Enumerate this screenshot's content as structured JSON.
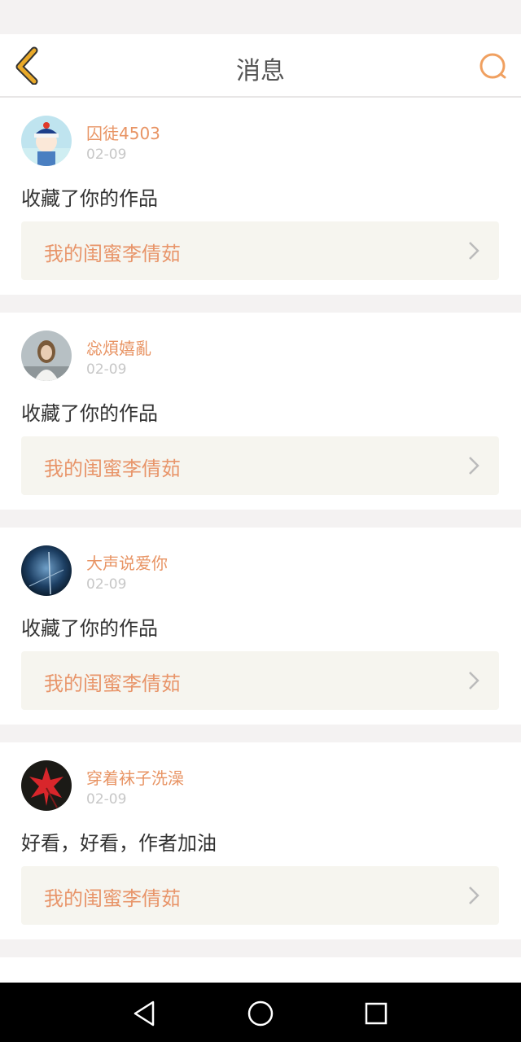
{
  "header": {
    "title": "消息",
    "back_icon": "back-chevron-icon",
    "search_icon": "search-icon"
  },
  "colors": {
    "accent": "#e89464",
    "back_icon": "#e9a929",
    "link_bg": "#f6f5ef"
  },
  "messages": [
    {
      "username": "囚徒4503",
      "date": "02-09",
      "comment": "收藏了你的作品",
      "work_title": "我的闺蜜李倩茹",
      "avatar": "avatar-cartoon"
    },
    {
      "username": "惢煩嬉亂",
      "date": "02-09",
      "comment": "收藏了你的作品",
      "work_title": "我的闺蜜李倩茹",
      "avatar": "avatar-photo-girl"
    },
    {
      "username": "大声说爱你",
      "date": "02-09",
      "comment": "收藏了你的作品",
      "work_title": "我的闺蜜李倩茹",
      "avatar": "avatar-photo-dark"
    },
    {
      "username": "穿着袜子洗澡",
      "date": "02-09",
      "comment": "好看，好看，作者加油",
      "work_title": "我的闺蜜李倩茹",
      "avatar": "avatar-red-leaf"
    }
  ],
  "navbar": {
    "back": "nav-back-icon",
    "home": "nav-home-icon",
    "recent": "nav-recent-icon"
  }
}
